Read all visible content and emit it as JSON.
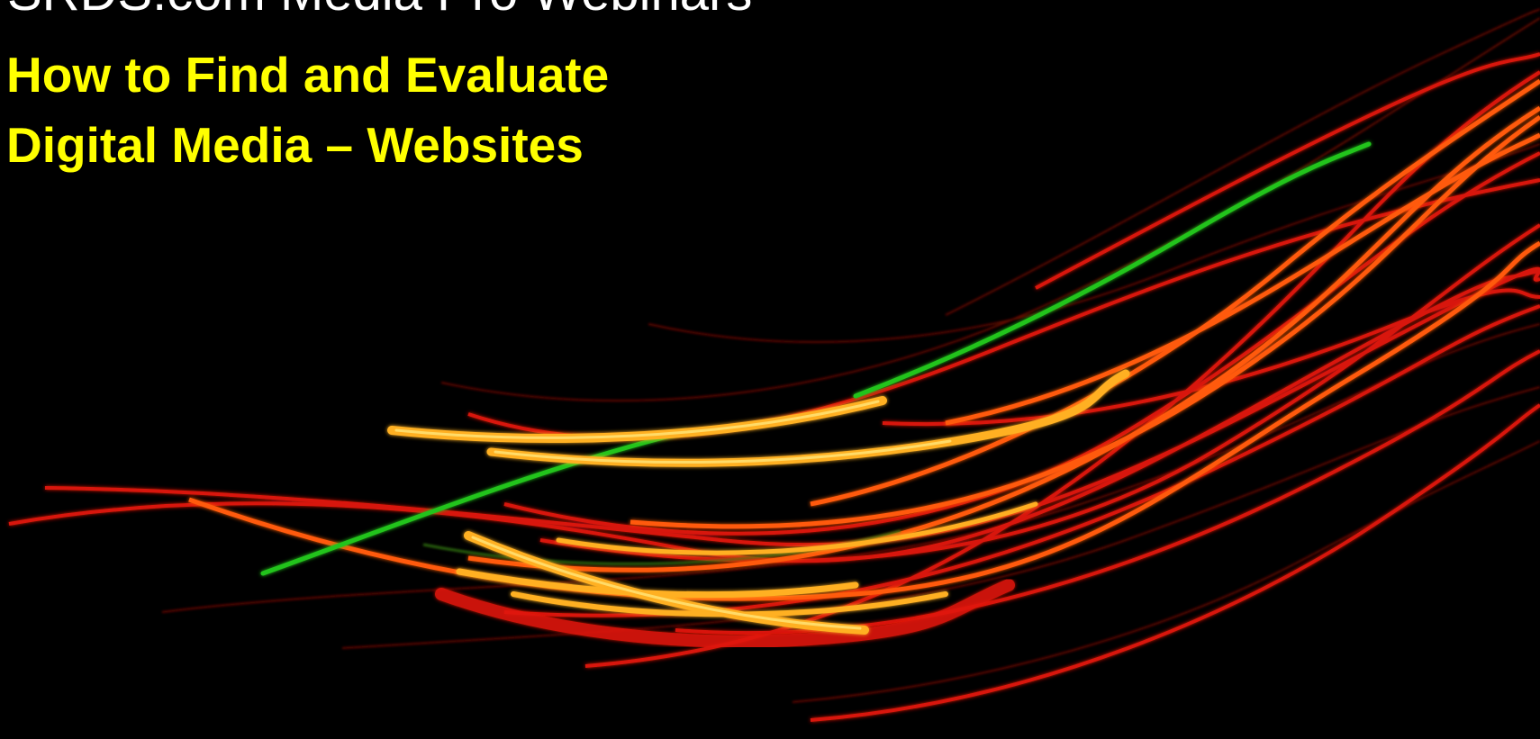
{
  "slide": {
    "title": "SRDS.com Media Pro Webinars",
    "subtitle_lines": [
      "How to Find and Evaluate",
      "Digital Media – Websites"
    ]
  },
  "colors": {
    "background": "#000000",
    "title": "#ffffff",
    "subtitle": "#ffff00",
    "streak_red": "#e01a0a",
    "streak_orange": "#ff6a10",
    "streak_yellow": "#ffb020",
    "streak_green": "#22c41a"
  }
}
